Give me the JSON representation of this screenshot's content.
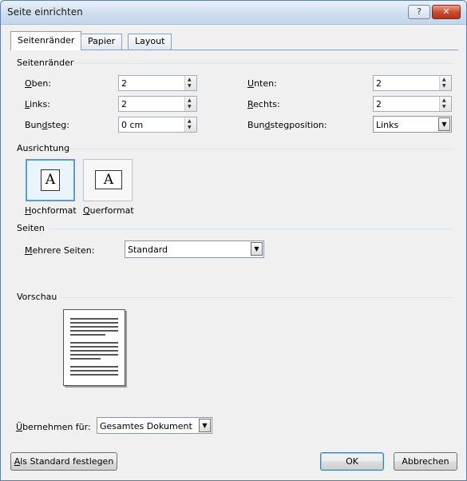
{
  "window": {
    "title": "Seite einrichten",
    "help_label": "?",
    "close_label": "✕"
  },
  "tabs": [
    {
      "label": "Seitenränder",
      "active": true
    },
    {
      "label": "Papier",
      "active": false
    },
    {
      "label": "Layout",
      "active": false
    }
  ],
  "margins": {
    "group_label": "Seitenränder",
    "oben": {
      "label_key": "O",
      "label_rest": "ben:",
      "value": "2"
    },
    "links": {
      "label_key": "L",
      "label_rest": "inks:",
      "value": "2"
    },
    "bundsteg": {
      "label_pre": "Bun",
      "label_key": "d",
      "label_rest": "steg:",
      "value": "0 cm"
    },
    "unten": {
      "label_key": "U",
      "label_rest": "nten:",
      "value": "2"
    },
    "rechts": {
      "label_key": "R",
      "label_rest": "echts:",
      "value": "2"
    },
    "bundstegposition": {
      "label_pre": "Bun",
      "label_key": "d",
      "label_rest": "stegposition:",
      "value": "Links"
    }
  },
  "orientation": {
    "group_label": "Ausrichtung",
    "hochformat": {
      "key": "H",
      "rest": "ochformat",
      "glyph": "A",
      "selected": true
    },
    "querformat": {
      "key": "Q",
      "rest": "uerformat",
      "glyph": "A",
      "selected": false
    }
  },
  "pages": {
    "group_label": "Seiten",
    "mehrere_label_key": "M",
    "mehrere_label_rest": "ehrere Seiten:",
    "mehrere_value": "Standard"
  },
  "preview": {
    "group_label": "Vorschau"
  },
  "apply": {
    "label_key": "Ü",
    "label_rest": "bernehmen für:",
    "value": "Gesamtes Dokument"
  },
  "buttons": {
    "default_key": "A",
    "default_rest": "ls Standard festlegen",
    "ok": "OK",
    "cancel": "Abbrechen"
  },
  "icons": {
    "spin": "spin-arrows-icon",
    "dropdown": "chevron-down-icon",
    "portrait": "portrait-page-icon",
    "landscape": "landscape-page-icon"
  }
}
